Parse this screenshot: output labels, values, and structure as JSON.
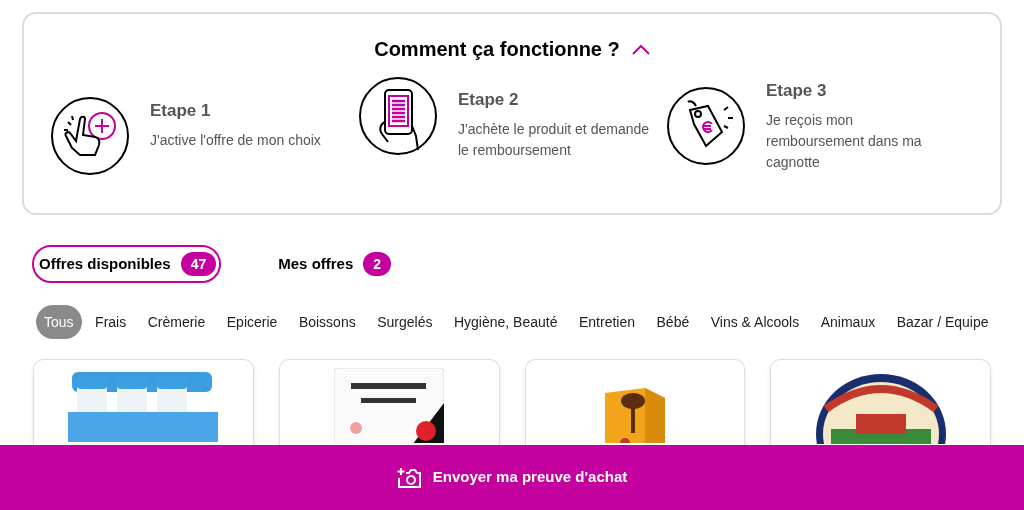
{
  "how_it_works": {
    "title": "Comment ça fonctionne ?",
    "expanded": true,
    "steps": [
      {
        "kind": "activate",
        "title": "Etape 1",
        "text": "J'active l'offre de mon choix"
      },
      {
        "kind": "buy",
        "title": "Etape 2",
        "text": "J'achète le produit et demande le remboursement"
      },
      {
        "kind": "refund",
        "title": "Etape 3",
        "text": "Je reçois mon remboursement dans ma cagnotte"
      }
    ]
  },
  "offer_tabs": [
    {
      "label": "Offres disponibles",
      "count": "47",
      "selected": true
    },
    {
      "label": "Mes offres",
      "count": "2",
      "selected": false
    }
  ],
  "categories": [
    {
      "label": "Tous",
      "selected": true
    },
    {
      "label": "Frais",
      "selected": false
    },
    {
      "label": "Crèmerie",
      "selected": false
    },
    {
      "label": "Epicerie",
      "selected": false
    },
    {
      "label": "Boissons",
      "selected": false
    },
    {
      "label": "Surgelés",
      "selected": false
    },
    {
      "label": "Hygiène, Beauté",
      "selected": false
    },
    {
      "label": "Entretien",
      "selected": false
    },
    {
      "label": "Bébé",
      "selected": false
    },
    {
      "label": "Vins & Alcools",
      "selected": false
    },
    {
      "label": "Animaux",
      "selected": false
    },
    {
      "label": "Bazar / Equipe",
      "selected": false
    }
  ],
  "bottom_bar": {
    "label": "Envoyer ma preuve d'achat"
  }
}
